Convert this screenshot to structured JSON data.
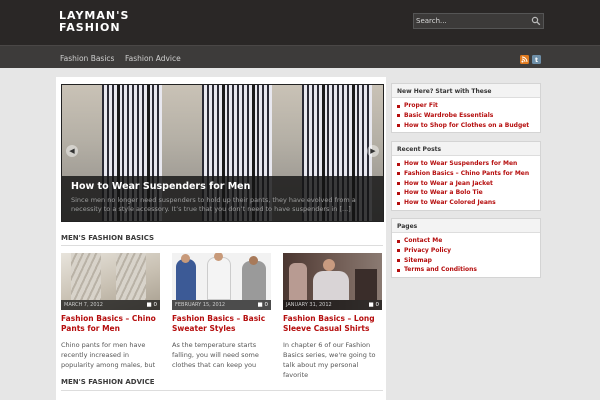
{
  "site": {
    "logo_line1": "LAYMAN'S",
    "logo_line2": "FASHION"
  },
  "search": {
    "placeholder": "Search..."
  },
  "nav": {
    "items": [
      {
        "label": "Fashion Basics"
      },
      {
        "label": "Fashion Advice"
      }
    ]
  },
  "social_icons": [
    "rss-icon",
    "twitter-icon"
  ],
  "slider": {
    "title": "How to Wear Suspenders for Men",
    "excerpt": "Since men no longer need suspenders to hold up their pants, they have evolved from a necessity to a style accessory. It’s true that you don’t need to have suspenders in [...]"
  },
  "sections": {
    "basics_title": "MEN'S FASHION BASICS",
    "advice_title": "MEN'S FASHION ADVICE"
  },
  "posts": [
    {
      "date": "MARCH 7, 2012",
      "comments": "0",
      "title": "Fashion Basics – Chino Pants for Men",
      "excerpt": "Chino pants for men have recently increased in popularity among males, but"
    },
    {
      "date": "FEBRUARY 15, 2012",
      "comments": "0",
      "title": "Fashion Basics – Basic Sweater Styles",
      "excerpt": "As the temperature starts falling, you will need some clothes that can keep you"
    },
    {
      "date": "JANUARY 31, 2012",
      "comments": "0",
      "title": "Fashion Basics – Long Sleeve Casual Shirts",
      "excerpt": "In chapter 6 of our Fashion Basics series, we're going to talk about my personal favorite"
    }
  ],
  "sidebar": {
    "start_here": {
      "title": "New Here? Start with These",
      "items": [
        "Proper Fit",
        "Basic Wardrobe Essentials",
        "How to Shop for Clothes on a Budget"
      ]
    },
    "recent": {
      "title": "Recent Posts",
      "items": [
        "How to Wear Suspenders for Men",
        "Fashion Basics – Chino Pants for Men",
        "How to Wear a Jean Jacket",
        "How to Wear a Bolo Tie",
        "How to Wear Colored Jeans"
      ]
    },
    "pages": {
      "title": "Pages",
      "items": [
        "Contact Me",
        "Privacy Policy",
        "Sitemap",
        "Terms and Conditions"
      ]
    }
  },
  "colors": {
    "header_bg": "#2a2726",
    "nav_bg": "#3d3b3a",
    "link_red": "#b50d0d",
    "page_bg": "#e6e6e6"
  }
}
